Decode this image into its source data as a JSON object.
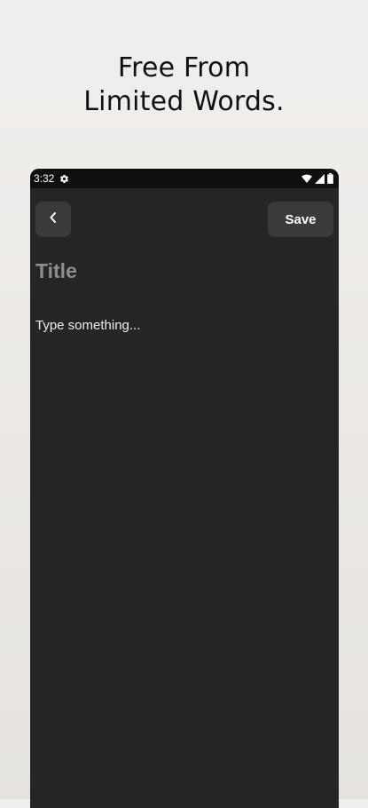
{
  "promo": {
    "line1": "Free From",
    "line2": "Limited Words."
  },
  "statusbar": {
    "time": "3:32",
    "icons": [
      "settings-gear-icon",
      "wifi-icon",
      "signal-icon",
      "battery-icon"
    ]
  },
  "editor": {
    "back_icon": "chevron-left-icon",
    "save_label": "Save",
    "title_placeholder": "Title",
    "body_placeholder": "Type something..."
  },
  "colors": {
    "background": "#252525",
    "statusbar": "#0f0f0f",
    "button": "#3a3a3a",
    "placeholder_title": "#8d8d8d",
    "text": "#ededed"
  }
}
